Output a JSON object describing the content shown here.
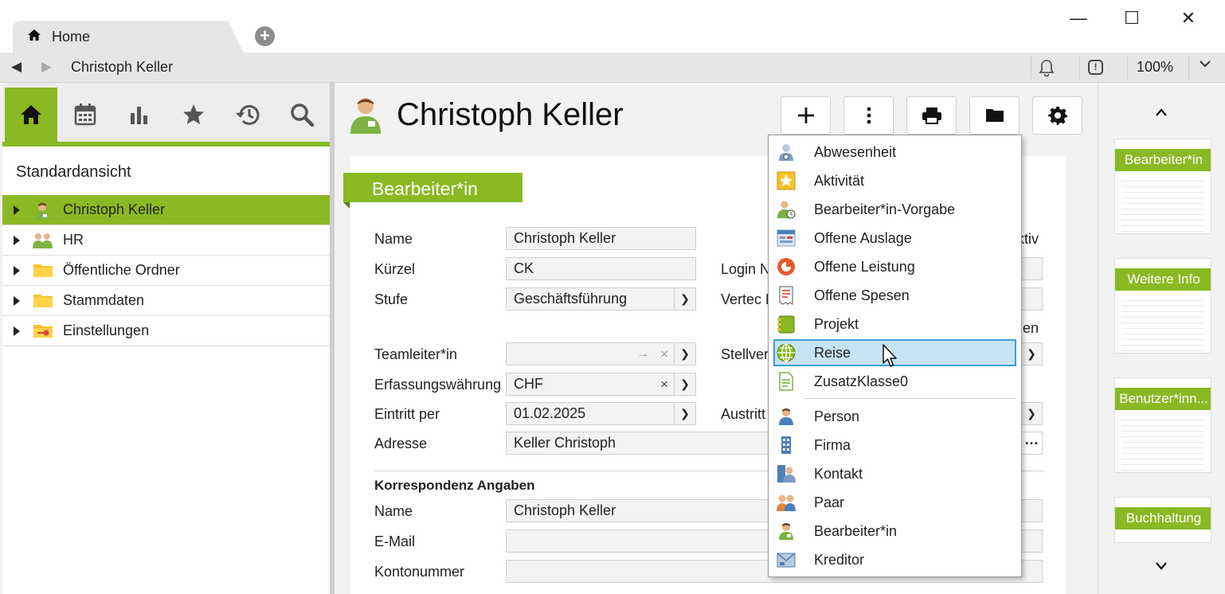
{
  "window": {
    "tab_label": "Home",
    "minimize": "—",
    "maximize": "☐",
    "close": "✕"
  },
  "nav": {
    "path": "Christoph Keller",
    "zoom": "100%"
  },
  "sidebar": {
    "title": "Standardansicht",
    "icons": [
      "home-icon",
      "calendar-icon",
      "chart-icon",
      "star-icon",
      "history-icon",
      "search-icon"
    ],
    "tree": [
      {
        "label": "Christoph Keller",
        "icon": "user-icon",
        "selected": true
      },
      {
        "label": "HR",
        "icon": "group-icon"
      },
      {
        "label": "Öffentliche Ordner",
        "icon": "folder-icon"
      },
      {
        "label": "Stammdaten",
        "icon": "folder-icon"
      },
      {
        "label": "Einstellungen",
        "icon": "settings-folder-icon"
      }
    ]
  },
  "main": {
    "title": "Christoph Keller",
    "badge": "Bearbeiter*in",
    "labels": {
      "name": "Name",
      "kuerzel": "Kürzel",
      "stufe": "Stufe",
      "teamleiter": "Teamleiter*in",
      "waehrung": "Erfassungswährung",
      "eintritt": "Eintritt per",
      "adresse": "Adresse",
      "login": "Login N",
      "vertec": "Vertec F",
      "stellv": "Stellvert",
      "austritt": "Austritt",
      "aktiv": "ktiv",
      "gen": "gen",
      "korr_heading": "Korrespondenz Angaben",
      "korr_name": "Name",
      "email": "E-Mail",
      "konto": "Kontonummer"
    },
    "values": {
      "name": "Christoph Keller",
      "kuerzel": "CK",
      "stufe": "Geschäftsführung",
      "teamleiter": "",
      "waehrung": "CHF",
      "eintritt": "01.02.2025",
      "adresse": "Keller Christoph",
      "korr_name": "Christoph Keller",
      "email": "",
      "konto": ""
    }
  },
  "menu": {
    "items": [
      {
        "label": "Abwesenheit",
        "icon": "absence-icon"
      },
      {
        "label": "Aktivität",
        "icon": "activity-icon"
      },
      {
        "label": "Bearbeiter*in-Vorgabe",
        "icon": "user-default-icon"
      },
      {
        "label": "Offene Auslage",
        "icon": "expense-icon"
      },
      {
        "label": "Offene Leistung",
        "icon": "service-icon"
      },
      {
        "label": "Offene Spesen",
        "icon": "receipt-icon"
      },
      {
        "label": "Projekt",
        "icon": "project-icon"
      },
      {
        "label": "Reise",
        "icon": "globe-icon",
        "hover": true
      },
      {
        "label": "ZusatzKlasse0",
        "icon": "document-icon"
      },
      {
        "label": "Person",
        "icon": "person-icon"
      },
      {
        "label": "Firma",
        "icon": "building-icon"
      },
      {
        "label": "Kontakt",
        "icon": "contact-icon"
      },
      {
        "label": "Paar",
        "icon": "couple-icon"
      },
      {
        "label": "Bearbeiter*in",
        "icon": "user-icon"
      },
      {
        "label": "Kreditor",
        "icon": "creditor-icon"
      }
    ]
  },
  "thumbs": [
    {
      "label": "Bearbeiter*in"
    },
    {
      "label": "Weitere Info"
    },
    {
      "label": "Benutzer*inn..."
    },
    {
      "label": "Buchhaltung"
    }
  ],
  "colors": {
    "accent": "#8ab924",
    "hover_bg": "#c7e2f2",
    "hover_border": "#3d9fd8"
  }
}
